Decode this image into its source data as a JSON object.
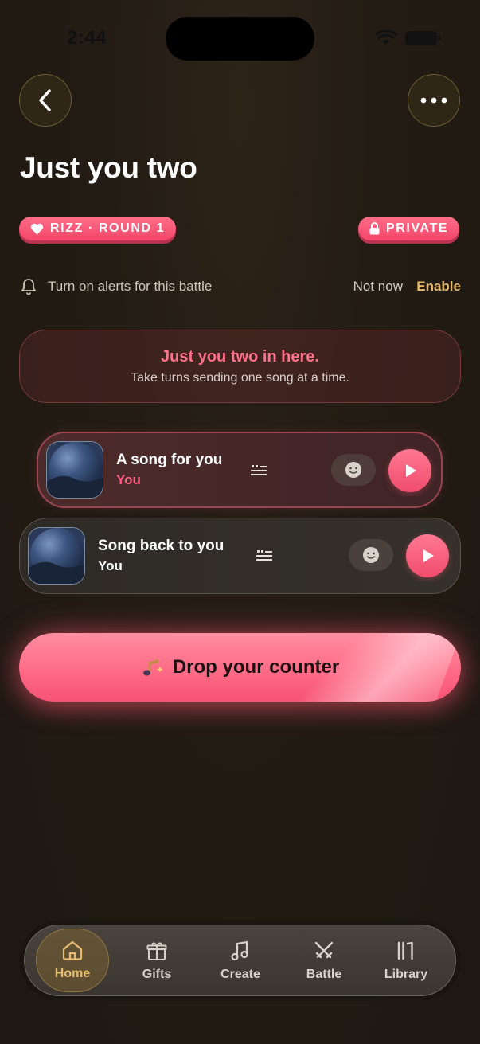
{
  "status_bar": {
    "time": "2:44"
  },
  "header": {
    "title": "Just you two"
  },
  "badges": {
    "round": "RIZZ · ROUND 1",
    "privacy": "PRIVATE"
  },
  "alerts": {
    "text": "Turn on alerts for this battle",
    "dismiss": "Not now",
    "enable": "Enable"
  },
  "info_card": {
    "title": "Just you two in here.",
    "subtitle": "Take turns sending one song at a time."
  },
  "tracks": [
    {
      "title": "A song for you",
      "artist": "You"
    },
    {
      "title": "Song back to you",
      "artist": "You"
    }
  ],
  "cta": {
    "label": "Drop your counter"
  },
  "tabbar": {
    "items": [
      {
        "label": "Home",
        "icon": "home-icon",
        "active": true
      },
      {
        "label": "Gifts",
        "icon": "gift-icon"
      },
      {
        "label": "Create",
        "icon": "music-note-icon"
      },
      {
        "label": "Battle",
        "icon": "crossed-swords-icon"
      },
      {
        "label": "Library",
        "icon": "library-icon"
      }
    ]
  },
  "colors": {
    "accent_pink": "#ff6b86",
    "accent_gold": "#e7b96a",
    "background": "#231c14"
  }
}
